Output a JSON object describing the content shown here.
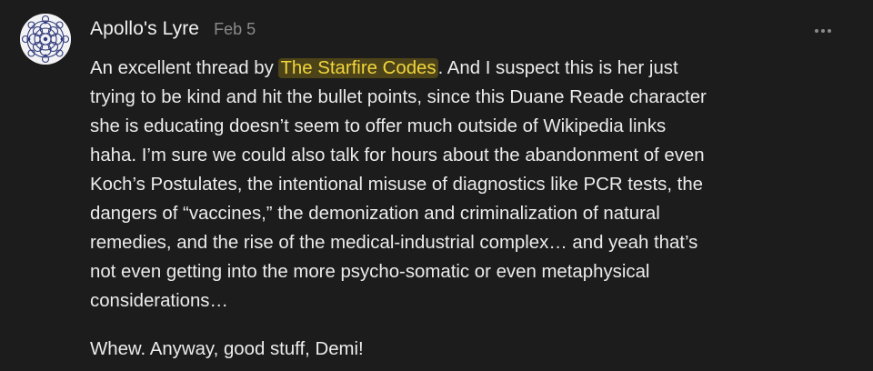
{
  "comment": {
    "author": "Apollo's Lyre",
    "date": "Feb 5",
    "more_menu_icon": "ellipsis-icon",
    "body": {
      "para1_before_mention": "An excellent thread by ",
      "mention": "The Starfire Codes",
      "lines": [
        ". And I suspect this is her just",
        "trying to be kind and hit the bullet points, since this Duane Reade character",
        "she is educating doesn’t seem to offer much outside of Wikipedia links",
        "haha. I’m sure we could also talk for hours about the abandonment of even",
        "Koch’s Postulates, the intentional misuse of diagnostics like PCR tests, the",
        "dangers of “vaccines,” the demonization and criminalization of natural",
        "remedies, and the rise of the medical-industrial complex… and yeah that’s",
        "not even getting into the more psycho-somatic or even metaphysical",
        "considerations…"
      ],
      "signoff": "Whew. Anyway, good stuff, Demi!"
    }
  },
  "colors": {
    "background": "#1c1c1c",
    "mention_bg": "#4d4319",
    "mention_text": "#f2d63b",
    "meta_text": "#8a8a8a"
  }
}
